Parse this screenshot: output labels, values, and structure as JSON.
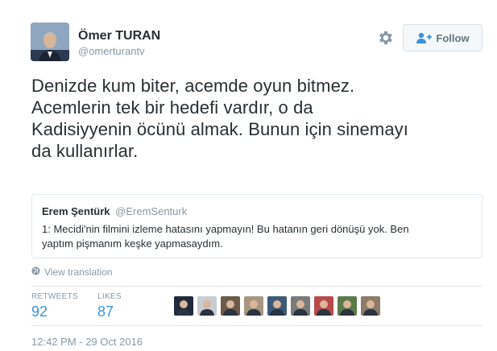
{
  "author": {
    "name": "Ömer TURAN",
    "handle": "@omerturantv",
    "avatar_icon": "profile-photo"
  },
  "header": {
    "gear_icon": "gear-icon",
    "follow_label": "Follow",
    "follow_icon": "add-user-icon"
  },
  "tweet": {
    "lines": [
      "Denizde kum biter, acemde oyun bitmez.",
      "Acemlerin tek bir hedefi vardır, o da",
      "Kadisiyyenin öcünü almak. Bunun için sinemayı",
      "da kullanırlar."
    ]
  },
  "quote": {
    "name": "Erem Şentürk",
    "handle": "@EremSenturk",
    "lines": [
      "1: Mecidi'nin filmini izleme hatasını yapmayın! Bu hatanın geri dönüşü yok. Ben",
      "yaptım pişmanım keşke yapmasaydım."
    ]
  },
  "translation": {
    "label": "View translation",
    "icon": "globe-icon"
  },
  "stats": {
    "retweets_label": "RETWEETS",
    "retweets_value": "92",
    "likes_label": "LIKES",
    "likes_value": "87"
  },
  "likers": [
    {
      "icon": "liker-avatar-1",
      "color": "#1f2a3a"
    },
    {
      "icon": "liker-avatar-2",
      "color": "#c9cdd2"
    },
    {
      "icon": "liker-avatar-3",
      "color": "#6b5a48"
    },
    {
      "icon": "liker-avatar-4",
      "color": "#a89680"
    },
    {
      "icon": "liker-avatar-5",
      "color": "#3d5a78"
    },
    {
      "icon": "liker-avatar-6",
      "color": "#7a7a7a"
    },
    {
      "icon": "liker-avatar-7",
      "color": "#b84a4a"
    },
    {
      "icon": "liker-avatar-8",
      "color": "#5b7a4a"
    },
    {
      "icon": "liker-avatar-9",
      "color": "#8c7b66"
    }
  ],
  "timestamp": "12:42 PM - 29 Oct 2016",
  "colors": {
    "link": "#3b94d9",
    "muted": "#8899a6",
    "text": "#292f33",
    "border": "#e1e8ed"
  }
}
